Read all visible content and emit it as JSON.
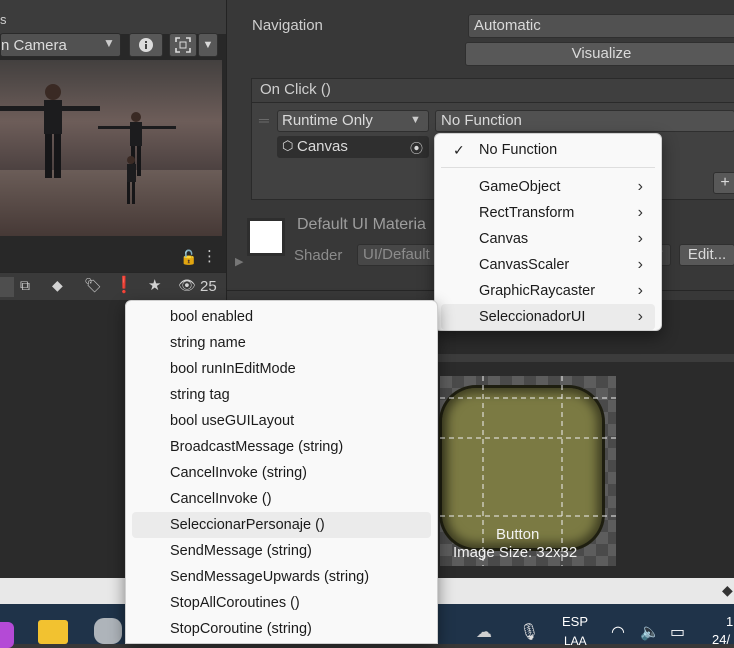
{
  "scene": {
    "toolbar_fragment": "s",
    "camera_dropdown": "n Camera",
    "info_icon": "info-circle-icon",
    "maximize_icon": "maximize-icon",
    "status_count": "25"
  },
  "inspector": {
    "navigation_label": "Navigation",
    "navigation_value": "Automatic",
    "visualize_label": "Visualize",
    "onclick_header": "On Click ()",
    "runtime_value": "Runtime Only",
    "function_value": "No Function",
    "target_object": "Canvas",
    "add_label": "+",
    "material_name": "Default UI Materia",
    "shader_label": "Shader",
    "shader_value": "UI/Default",
    "edit_label": "Edit..."
  },
  "preview": {
    "caption": "Button",
    "size_text": "Image Size: 32x32",
    "fill_color": "#7b7a43"
  },
  "function_menu": {
    "checked_item": "No Function",
    "items": [
      "GameObject",
      "RectTransform",
      "Canvas",
      "CanvasScaler",
      "GraphicRaycaster",
      "SeleccionadorUI"
    ]
  },
  "method_menu": {
    "items": [
      "bool enabled",
      "string name",
      "bool runInEditMode",
      "string tag",
      "bool useGUILayout",
      "BroadcastMessage (string)",
      "CancelInvoke (string)",
      "CancelInvoke ()",
      "SeleccionarPersonaje ()",
      "SendMessage (string)",
      "SendMessageUpwards (string)",
      "StopAllCoroutines ()",
      "StopCoroutine (string)"
    ]
  },
  "taskbar": {
    "lang_top": "ESP",
    "lang_bottom": "LAA",
    "clock_top": "1",
    "clock_bottom": "24/"
  }
}
